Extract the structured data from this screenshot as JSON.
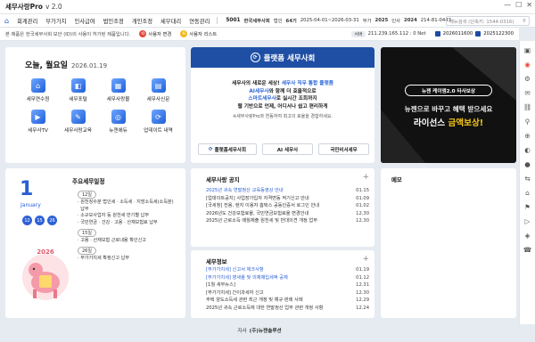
{
  "window": {
    "app": "세무사랑Pro",
    "version": "v 2.0",
    "controls": [
      "—",
      "☐",
      "✕"
    ]
  },
  "menu": {
    "items": [
      "회계관리",
      "부가가치",
      "인사급여",
      "법인조정",
      "개인조정",
      "세무대리",
      "연동관리"
    ],
    "company_code": "5001",
    "company_name": "한국세무사회",
    "corp_badge": "법인",
    "fiscal_no": "64기",
    "period": "2025-04-01~2026-03-31",
    "year_label": "부가",
    "year": "2025",
    "tax_label": "인사",
    "tax_year": "2024",
    "user": "214-81-0443",
    "search_placeholder": "메뉴검색 (단축키: 1544-0316)"
  },
  "notice": {
    "text": "본 제품은 한국세무사회 보안 (ID)의 사용이 허가된 제품입니다.",
    "user_change": "사용자 변경",
    "user_list": "사용자 리스트",
    "ip_tag": "서버",
    "ip": "211.239.165.112 : 0 Net",
    "num1": "2026011600",
    "num2": "2025122300"
  },
  "today": {
    "title": "오늘, 월요일",
    "date": "2026.01.19",
    "tiles": [
      {
        "label": "세무연수원",
        "glyph": "⌂"
      },
      {
        "label": "세무포털",
        "glyph": "◧"
      },
      {
        "label": "세무사랑몰",
        "glyph": "▦"
      },
      {
        "label": "세무사신문",
        "glyph": "▤"
      },
      {
        "label": "세무사TV",
        "glyph": "▶"
      },
      {
        "label": "세무사랑교육",
        "glyph": "✎"
      },
      {
        "label": "뉴젠에듀",
        "glyph": "◎"
      },
      {
        "label": "업데이트 내역",
        "glyph": "⟳"
      }
    ]
  },
  "tax_society": {
    "header": "플랫폼 세무사회",
    "logo": "⟳",
    "lines": [
      {
        "a": "세무사의 새로운 세상! ",
        "b": "세무사 직무 통합 플랫폼",
        "c": ""
      },
      {
        "a": "",
        "b": "AI세무사",
        "c": "와 함께 더 효율적으로"
      },
      {
        "a": "",
        "b": "스마트세무사",
        "c": "로 실시간 조회까지"
      },
      {
        "a": "웹 기반으로 언제, 어디서나 쉽고 편리하게",
        "b": "",
        "c": ""
      }
    ],
    "small": "※세무사랑Pro와 연동하여 최고의 효율을 경험하세요.",
    "buttons": [
      "플랫폼세무사회",
      "AI 세무사",
      "국민비서세무"
    ]
  },
  "banner": {
    "pill": "뉴젠 케이엠2.0 타사보상",
    "line1": "뉴젠으로 바꾸고 혜택 받으세요",
    "line2a": "라이선스 ",
    "line2b": "금액보상!",
    "colors": {
      "bg": "#111111",
      "accent": "#f5c518"
    }
  },
  "schedule": {
    "title": "주요세무일정",
    "day": "1",
    "month": "January",
    "marks": [
      "12",
      "15",
      "26"
    ],
    "art_text": "2026",
    "groups": [
      {
        "tag": "12일",
        "items": [
          "원천징수분 법인세 · 소득세 · 지방소득세(소득분)",
          "납부",
          "소규모사업자 등 원천세 반기별 납부",
          "국민연금 · 건강 · 고용 · 산재보험료 납부"
        ]
      },
      {
        "tag": "15일",
        "items": [
          "고용 · 산재보험 근로내용 확인신고"
        ]
      },
      {
        "tag": "26일",
        "items": [
          "부가가치세 확정신고 납부"
        ]
      }
    ]
  },
  "notices": {
    "title": "세무사랑 공지",
    "rows": [
      {
        "t": "2025년 귀속 연말정산 교육동영상 안내",
        "d": "01.15",
        "blue": true
      },
      {
        "t": "[업데이트공지] 사업장가입자 자격변동 적기신고 안내",
        "d": "01.09",
        "blue": false
      },
      {
        "t": "[국세청] 전용, 렌지 이용자 홈택스 공동인증서 로그인 안내",
        "d": "01.02",
        "blue": false
      },
      {
        "t": "2026년도 건강보험료율, 국민연금보험료율 변경안내",
        "d": "12.30",
        "blue": false
      },
      {
        "t": "2025년 근로소득 매월제출 원천세 및 반대의견 개정 업무",
        "d": "12.30",
        "blue": false
      }
    ]
  },
  "taxinfo": {
    "title": "세무정보",
    "rows": [
      {
        "t": "[부가가치세] 신고서 체크사항",
        "d": "01.19",
        "blue": true
      },
      {
        "t": "[부가가치세] 영세율 및 의제매입세액 공제",
        "d": "01.12",
        "blue": true
      },
      {
        "t": "[1월 세무뉴스]",
        "d": "12.31",
        "blue": false
      },
      {
        "t": "[부가가치세] 간이과세자 신고",
        "d": "12.30",
        "blue": false
      },
      {
        "t": "주택 양도소득세 관련 최근 개정 및 예규·판례 사례",
        "d": "12.29",
        "blue": false
      },
      {
        "t": "2025년 귀속 근로소득에 대한 연말정산 업무 관련 개정 사항",
        "d": "12.24",
        "blue": false
      }
    ]
  },
  "memo": {
    "title": "메모"
  },
  "footer": {
    "label": "지사",
    "company": "(주)뉴젠솔루션"
  },
  "rightbar": [
    "▣",
    "◉",
    "⚙",
    "✉",
    "⛓",
    "⚲",
    "⊕",
    "◐",
    "●",
    "⇆",
    "⌂",
    "⚑",
    "▷",
    "◈",
    "☎"
  ]
}
